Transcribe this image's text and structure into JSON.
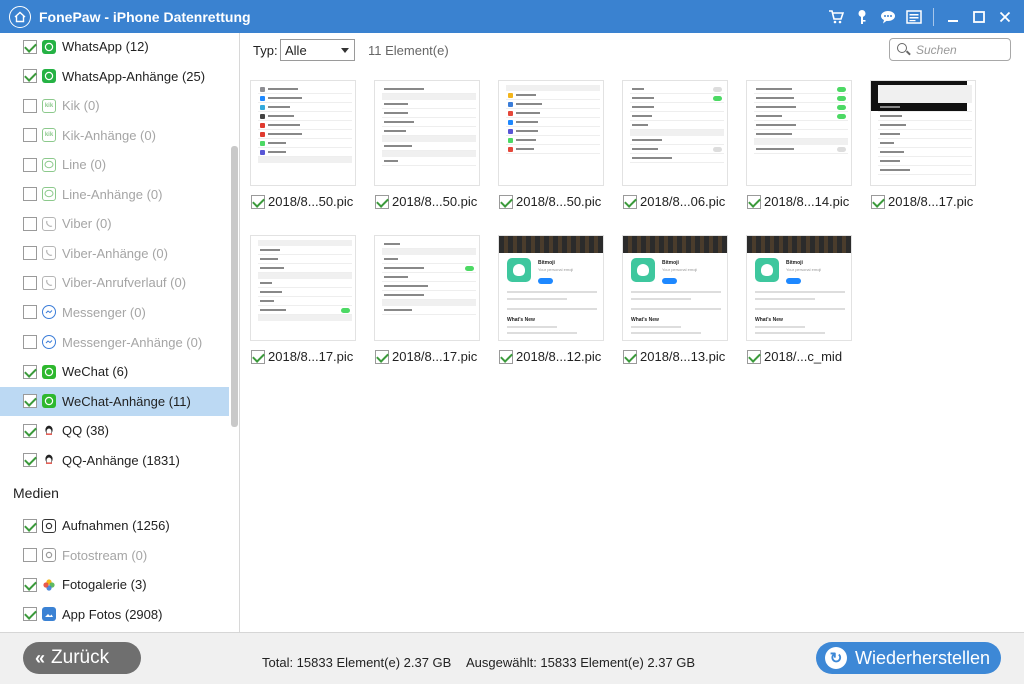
{
  "window": {
    "title": "FonePaw - iPhone Datenrettung",
    "accent_color": "#3a82d0",
    "tools": [
      "cart-icon",
      "key-icon",
      "chat-icon",
      "register-icon"
    ],
    "window_controls": [
      "minimize",
      "maximize",
      "close"
    ]
  },
  "sidebar": {
    "items": [
      {
        "label": "WhatsApp (12)",
        "checked": true,
        "enabled": true,
        "icon": "whatsapp-icon"
      },
      {
        "label": "WhatsApp-Anhänge (25)",
        "checked": true,
        "enabled": true,
        "icon": "whatsapp-icon"
      },
      {
        "label": "Kik (0)",
        "checked": false,
        "enabled": false,
        "icon": "kik-icon"
      },
      {
        "label": "Kik-Anhänge (0)",
        "checked": false,
        "enabled": false,
        "icon": "kik-icon"
      },
      {
        "label": "Line (0)",
        "checked": false,
        "enabled": false,
        "icon": "line-icon"
      },
      {
        "label": "Line-Anhänge (0)",
        "checked": false,
        "enabled": false,
        "icon": "line-icon"
      },
      {
        "label": "Viber (0)",
        "checked": false,
        "enabled": false,
        "icon": "viber-icon"
      },
      {
        "label": "Viber-Anhänge (0)",
        "checked": false,
        "enabled": false,
        "icon": "viber-icon"
      },
      {
        "label": "Viber-Anrufverlauf (0)",
        "checked": false,
        "enabled": false,
        "icon": "viber-icon"
      },
      {
        "label": "Messenger (0)",
        "checked": false,
        "enabled": false,
        "icon": "messenger-icon"
      },
      {
        "label": "Messenger-Anhänge (0)",
        "checked": false,
        "enabled": false,
        "icon": "messenger-icon"
      },
      {
        "label": "WeChat (6)",
        "checked": true,
        "enabled": true,
        "icon": "wechat-icon"
      },
      {
        "label": "WeChat-Anhänge (11)",
        "checked": true,
        "enabled": true,
        "icon": "wechat-icon",
        "selected": true
      },
      {
        "label": "QQ (38)",
        "checked": true,
        "enabled": true,
        "icon": "qq-icon"
      },
      {
        "label": "QQ-Anhänge (1831)",
        "checked": true,
        "enabled": true,
        "icon": "qq-icon"
      }
    ],
    "section_medien": "Medien",
    "media_items": [
      {
        "label": "Aufnahmen (1256)",
        "checked": true,
        "enabled": true,
        "icon": "camera-icon"
      },
      {
        "label": "Fotostream (0)",
        "checked": false,
        "enabled": false,
        "icon": "camera-icon"
      },
      {
        "label": "Fotogalerie (3)",
        "checked": true,
        "enabled": true,
        "icon": "photos-icon"
      },
      {
        "label": "App Fotos (2908)",
        "checked": true,
        "enabled": true,
        "icon": "image-icon"
      }
    ]
  },
  "toolbar": {
    "type_label": "Typ:",
    "type_value": "Alle",
    "count": "11 Element(e)",
    "search_placeholder": "Suchen"
  },
  "files": [
    {
      "name": "2018/8...50.pic",
      "checked": true,
      "thumb": "settings-list"
    },
    {
      "name": "2018/8...50.pic",
      "checked": true,
      "thumb": "settings-general"
    },
    {
      "name": "2018/8...50.pic",
      "checked": true,
      "thumb": "storage-list"
    },
    {
      "name": "2018/8...06.pic",
      "checked": true,
      "thumb": "camera-settings"
    },
    {
      "name": "2018/8...14.pic",
      "checked": true,
      "thumb": "safari-settings"
    },
    {
      "name": "2018/8...17.pic",
      "checked": true,
      "thumb": "menu-dark"
    },
    {
      "name": "2018/8...17.pic",
      "checked": true,
      "thumb": "chrome-settings"
    },
    {
      "name": "2018/8...17.pic",
      "checked": true,
      "thumb": "chrome-privacy"
    },
    {
      "name": "2018/8...12.pic",
      "checked": true,
      "thumb": "bitmoji"
    },
    {
      "name": "2018/8...13.pic",
      "checked": true,
      "thumb": "bitmoji"
    },
    {
      "name": "2018/...c_mid",
      "checked": true,
      "thumb": "bitmoji"
    }
  ],
  "footer": {
    "back_label": "Zurück",
    "total": "Total: 15833 Element(e) 2.37 GB",
    "selected": "Ausgewählt: 15833 Element(e) 2.37 GB",
    "restore_label": "Wiederherstellen"
  }
}
